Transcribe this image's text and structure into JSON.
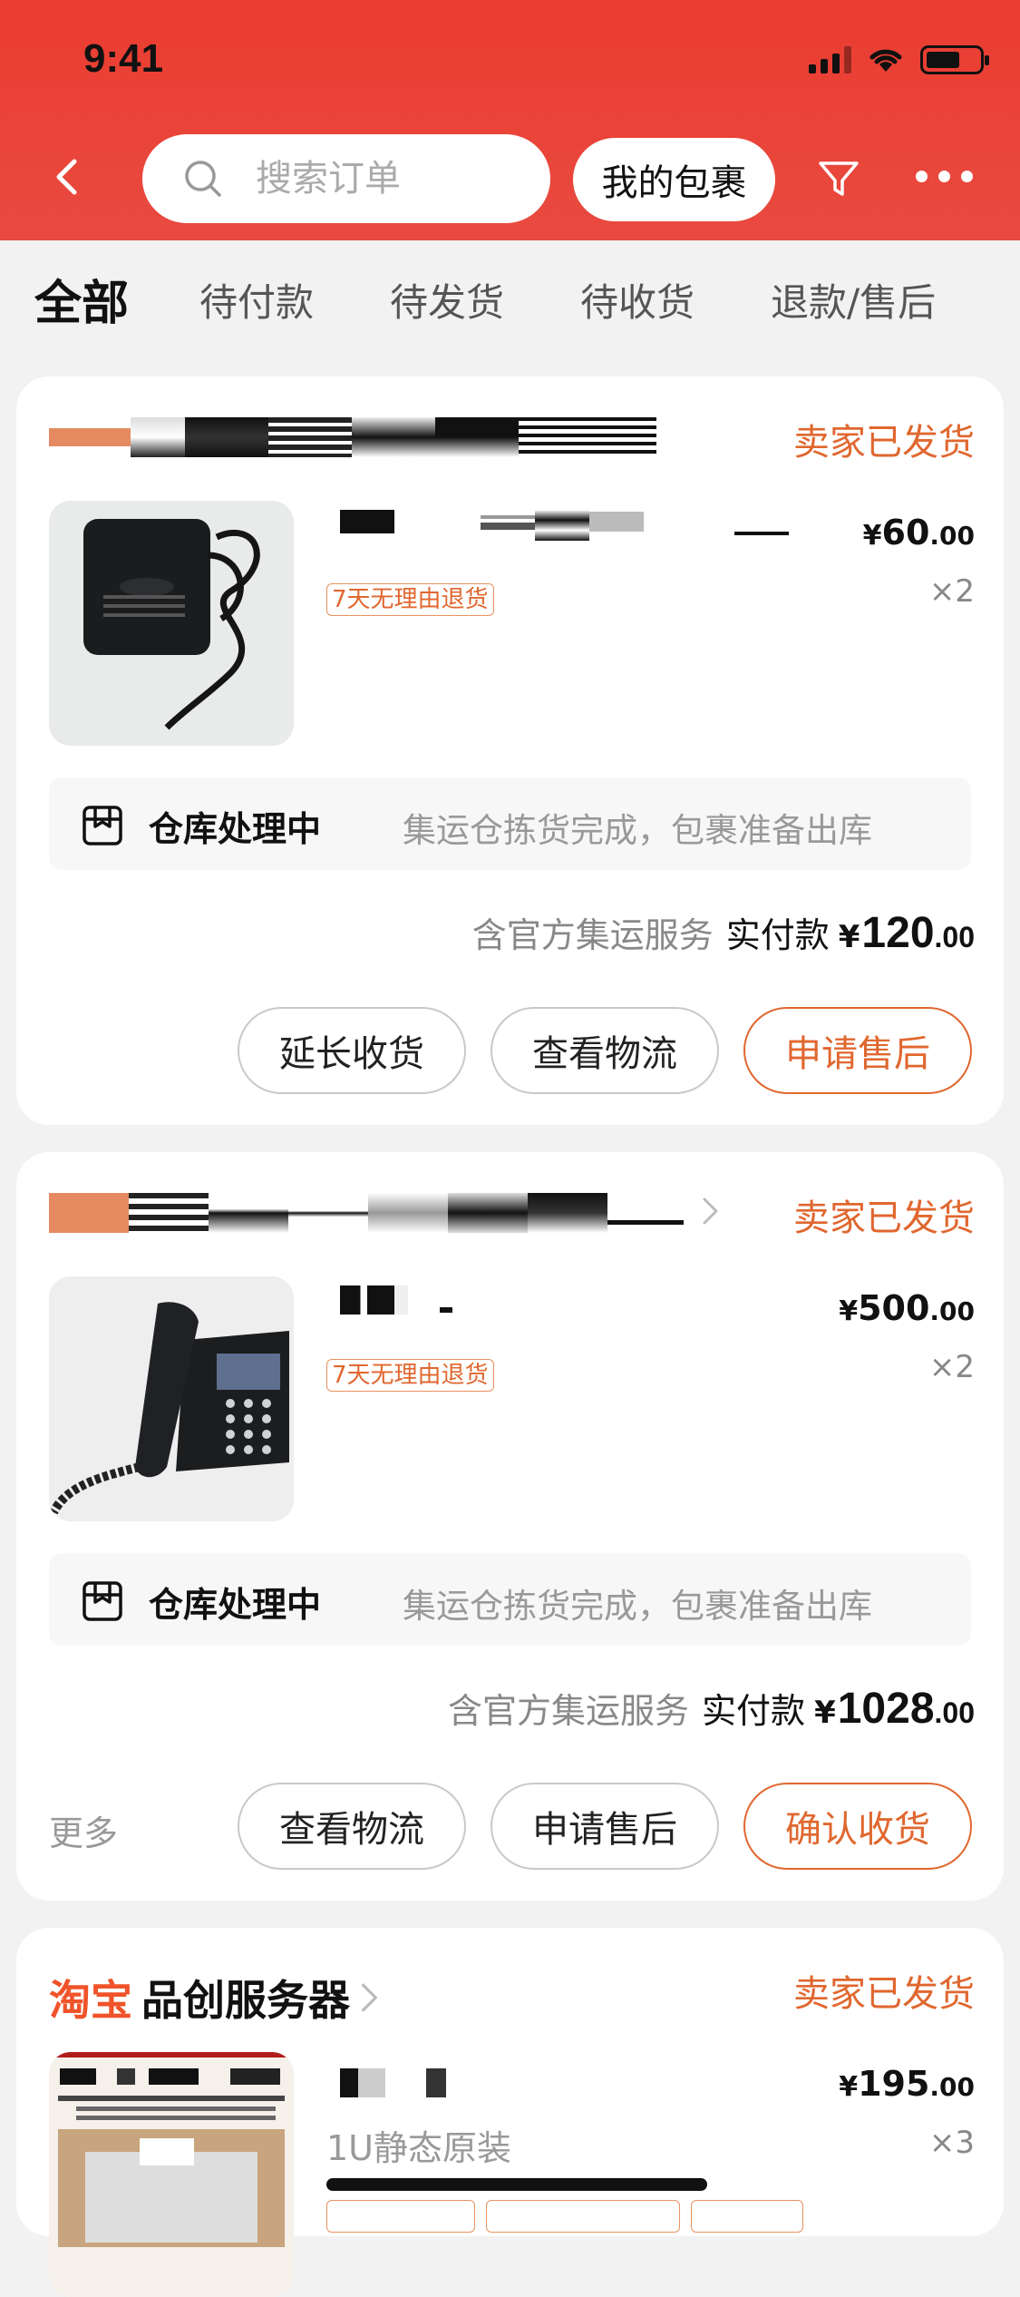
{
  "status_bar": {
    "time": "9:41"
  },
  "header": {
    "search_placeholder": "搜索订单",
    "my_packages_label": "我的包裹"
  },
  "tabs": [
    {
      "label": "全部",
      "active": true
    },
    {
      "label": "待付款"
    },
    {
      "label": "待发货"
    },
    {
      "label": "待收货"
    },
    {
      "label": "退款/售后"
    }
  ],
  "orders": [
    {
      "status": "卖家已发货",
      "price_yen": "¥",
      "price_int": "60",
      "price_dec": ".00",
      "qty": "×2",
      "return_tag": "7天无理由退货",
      "warehouse_title": "仓库处理中",
      "warehouse_desc": "集运仓拣货完成，包裹准备出库",
      "service_note": "含官方集运服务",
      "paid_label": "实付款",
      "paid_yen": "¥",
      "paid_int": "120",
      "paid_dec": ".00",
      "buttons": [
        "延长收货",
        "查看物流",
        "申请售后"
      ]
    },
    {
      "status": "卖家已发货",
      "price_yen": "¥",
      "price_int": "500",
      "price_dec": ".00",
      "qty": "×2",
      "return_tag": "7天无理由退货",
      "warehouse_title": "仓库处理中",
      "warehouse_desc": "集运仓拣货完成，包裹准备出库",
      "service_note": "含官方集运服务",
      "paid_label": "实付款",
      "paid_yen": "¥",
      "paid_int": "1028",
      "paid_dec": ".00",
      "more_label": "更多",
      "buttons": [
        "查看物流",
        "申请售后",
        "确认收货"
      ]
    },
    {
      "shop_brand": "淘宝",
      "shop_name": "品创服务器",
      "status": "卖家已发货",
      "price_yen": "¥",
      "price_int": "195",
      "price_dec": ".00",
      "qty": "×3",
      "subtitle": "1U静态原装"
    }
  ],
  "colors": {
    "header_red": "#ea3c30",
    "accent_orange": "#e0672f"
  }
}
